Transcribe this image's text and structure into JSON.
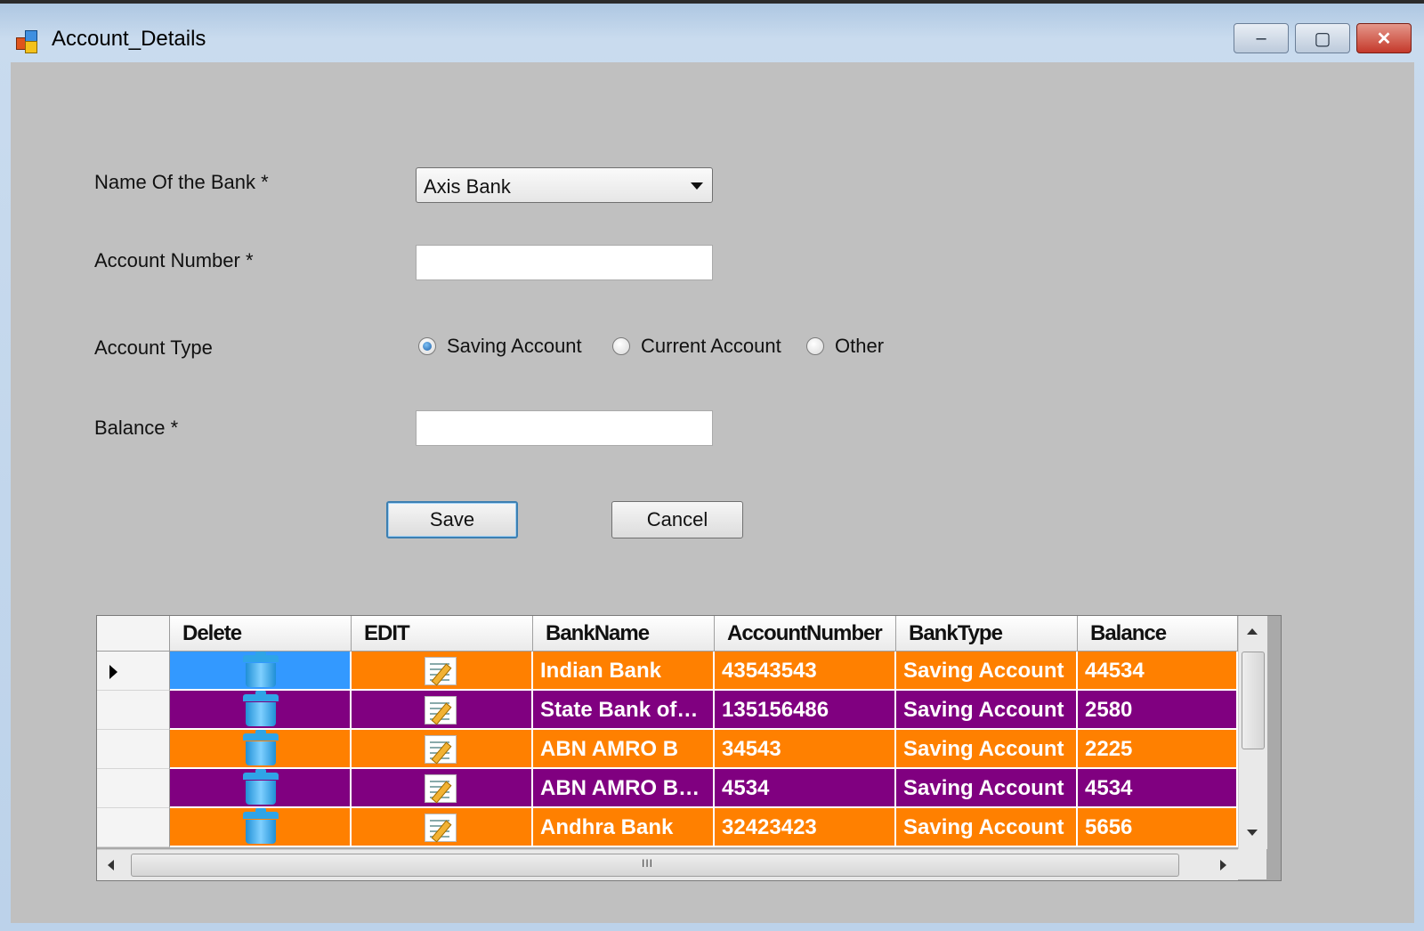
{
  "window": {
    "title": "Account_Details",
    "controls": {
      "minimize": "–",
      "maximize": "▢",
      "close": "✕"
    }
  },
  "form": {
    "bank_label": "Name Of the Bank *",
    "bank_value": "Axis Bank",
    "account_number_label": "Account Number *",
    "account_number_value": "",
    "account_type_label": "Account Type",
    "account_types": [
      {
        "label": "Saving Account",
        "checked": true
      },
      {
        "label": "Current Account",
        "checked": false
      },
      {
        "label": "Other",
        "checked": false
      }
    ],
    "balance_label": "Balance *",
    "balance_value": "",
    "save_label": "Save",
    "cancel_label": "Cancel"
  },
  "grid": {
    "columns": [
      "Delete",
      "EDIT",
      "BankName",
      "AccountNumber",
      "BankType",
      "Balance"
    ],
    "rows": [
      {
        "bank_name": "Indian Bank",
        "account_number": "43543543",
        "bank_type": "Saving Account",
        "balance": "44534",
        "color": "orange"
      },
      {
        "bank_name": "State Bank of…",
        "account_number": "135156486",
        "bank_type": "Saving Account",
        "balance": "2580",
        "color": "purple"
      },
      {
        "bank_name": "ABN AMRO B",
        "account_number": "34543",
        "bank_type": "Saving Account",
        "balance": "2225",
        "color": "orange"
      },
      {
        "bank_name": "ABN AMRO B…",
        "account_number": "4534",
        "bank_type": "Saving Account",
        "balance": "4534",
        "color": "purple"
      },
      {
        "bank_name": "Andhra Bank",
        "account_number": "32423423",
        "bank_type": "Saving Account",
        "balance": "5656",
        "color": "orange"
      }
    ],
    "row_colors": {
      "orange": "#ff8000",
      "purple": "#800080",
      "selected": "#3399ff"
    },
    "hscroll_grip": "III"
  }
}
